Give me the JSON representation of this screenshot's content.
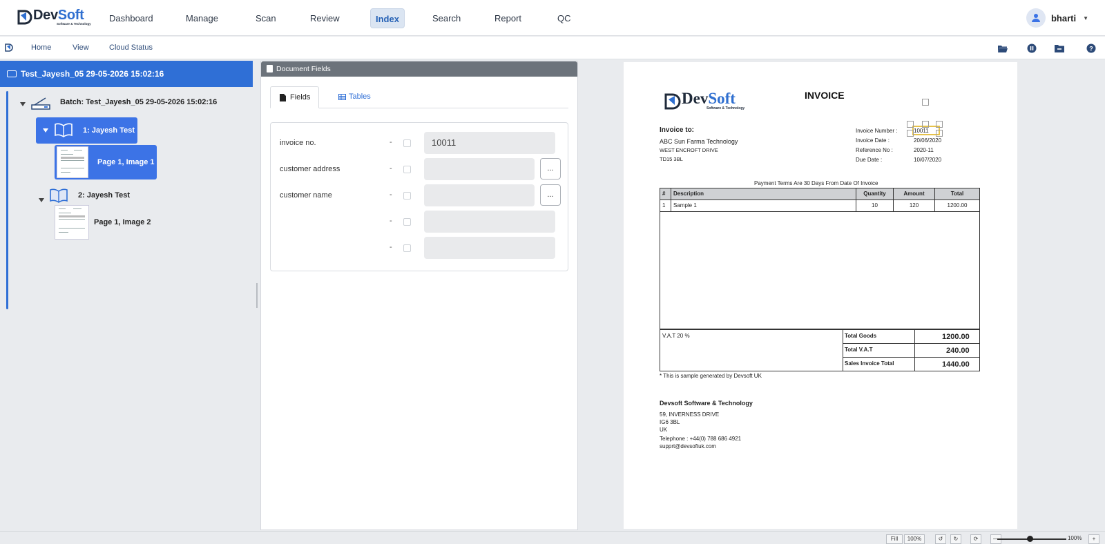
{
  "brand": {
    "name_dark": "Dev",
    "name_accent": "Soft",
    "tagline": "Software & Technology"
  },
  "nav": {
    "items": [
      {
        "label": "Dashboard"
      },
      {
        "label": "Manage"
      },
      {
        "label": "Scan"
      },
      {
        "label": "Review"
      },
      {
        "label": "Index",
        "active": true
      },
      {
        "label": "Search"
      },
      {
        "label": "Report"
      },
      {
        "label": "QC"
      }
    ],
    "user": "bharti"
  },
  "subnav": {
    "items": [
      {
        "label": "Home"
      },
      {
        "label": "View"
      },
      {
        "label": "Cloud Status"
      }
    ]
  },
  "tree": {
    "header": "Test_Jayesh_05 29-05-2026 15:02:16",
    "batch": "Batch: Test_Jayesh_05 29-05-2026 15:02:16",
    "documents": [
      {
        "label": "1: Jayesh Test",
        "page": "Page 1, Image 1"
      },
      {
        "label": "2: Jayesh Test",
        "page": "Page 1, Image 2"
      }
    ]
  },
  "document_fields": {
    "title": "Document Fields",
    "tabs": {
      "fields": "Fields",
      "tables": "Tables"
    },
    "rows": [
      {
        "label": "invoice no.",
        "dash": "-",
        "value": "10011",
        "button": ""
      },
      {
        "label": "customer address",
        "dash": "-",
        "value": "",
        "button": "..."
      },
      {
        "label": "customer name",
        "dash": "-",
        "value": "",
        "button": "..."
      },
      {
        "label": "",
        "dash": "-",
        "value": "",
        "button": ""
      },
      {
        "label": "",
        "dash": "-",
        "value": "",
        "button": ""
      }
    ]
  },
  "invoice": {
    "logo_dark": "Dev",
    "logo_accent": "Soft",
    "logo_tagline": "Software & Technology",
    "title": "INVOICE",
    "to_label": "Invoice to:",
    "to_lines": [
      "ABC Sun Farma Technology",
      "WEST ENCROFT DRIVE",
      "TD15 3BL"
    ],
    "meta": [
      {
        "k": "Invoice Number :",
        "v": "10011"
      },
      {
        "k": "Invoice Date :",
        "v": "20/06/2020"
      },
      {
        "k": "Reference No :",
        "v": "2020-11"
      },
      {
        "k": "Due Date :",
        "v": "10/07/2020"
      }
    ],
    "payment_terms": "Payment Terms Are 30 Days From Date Of Invoice",
    "columns": [
      "#",
      "Description",
      "Quantity",
      "Amount",
      "Total"
    ],
    "line": {
      "no": "1",
      "desc": "Sample 1",
      "qty": "10",
      "amount": "120",
      "total": "1200.00"
    },
    "vat_label": "V.A.T 20 %",
    "totals": [
      {
        "k": "Total Goods",
        "v": "1200.00"
      },
      {
        "k": "Total V.A.T",
        "v": "240.00"
      },
      {
        "k": "Sales Invoice Total",
        "v": "1440.00"
      }
    ],
    "note": "* This is sample generated by Devsoft UK",
    "company": "Devsoft Software & Technology",
    "address": [
      "59, INVERNESS DRIVE",
      "IG6 3BL",
      "UK",
      "Telephone : +44(0) 788 686 4921",
      "supprt@devsoftuk.com"
    ]
  },
  "statusbar": {
    "fill": "Fill",
    "zoom_box": "100%",
    "zoom": "100%",
    "minus": "—",
    "plus": "+"
  },
  "colors": {
    "accent": "#2f6fd6",
    "nav_active_bg": "#dbe5f2",
    "panel_header": "#6c737b"
  }
}
